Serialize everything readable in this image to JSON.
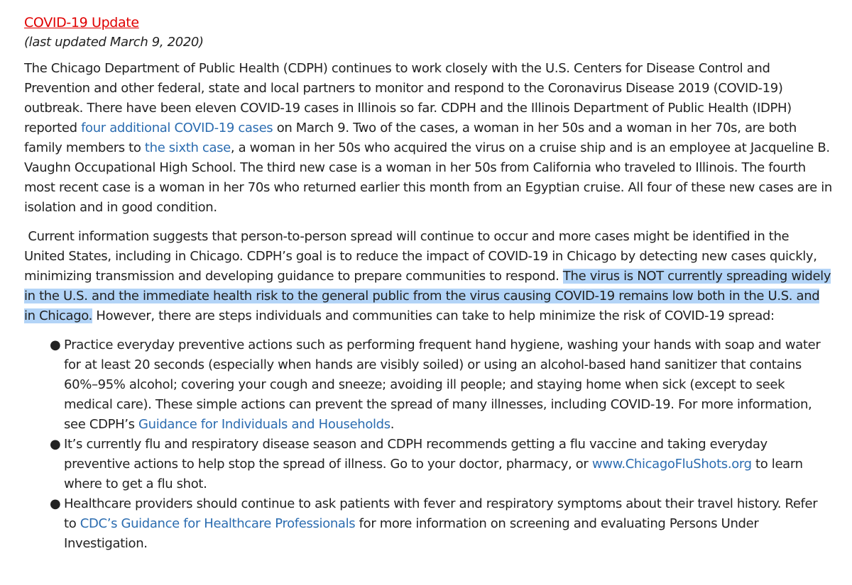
{
  "header": {
    "title": "COVID-19 Update",
    "updated": "(last updated March 9, 2020)"
  },
  "para1": {
    "t1": "The Chicago Department of Public Health (CDPH) continues to work closely with the U.S. Centers for Disease Control and Prevention and other federal, state and local partners to monitor and respond to the Coronavirus Disease 2019 (COVID-19) outbreak. There have been eleven COVID-19 cases in Illinois so far. CDPH and the Illinois Department of Public Health (IDPH) reported ",
    "link1": "four additional COVID-19 cases",
    "t2": " on March 9. Two of the cases, a woman in her 50s and a woman in her 70s, are both family members to ",
    "link2": "the sixth case",
    "t3": ", a woman in her 50s who acquired the virus on a cruise ship and is an employee at Jacqueline B. Vaughn Occupational High School. The third new case is a woman in her 50s from California who traveled to Illinois. The fourth most recent case is a woman in her 70s who returned earlier this month from an Egyptian cruise. All four of these new cases are in isolation and in good condition."
  },
  "para2": {
    "t1": " Current information suggests that person-to-person spread will continue to occur and more cases might be identified in the United States, including in Chicago. CDPH’s goal is to reduce the impact of COVID-19 in Chicago by detecting new cases quickly, minimizing transmission and developing guidance to prepare communities to respond. ",
    "highlight": "The virus is NOT currently spreading widely in the U.S. and the immediate health risk to the general public from the virus causing COVID-19 remains low both in the U.S. and in Chicago.",
    "t2": " However, there are steps individuals and communities can take to help minimize the risk of COVID-19 spread:"
  },
  "bullets": [
    {
      "t1": "Practice everyday preventive actions such as performing frequent hand hygiene, washing your hands with soap and water for at least 20 seconds (especially when hands are visibly soiled) or using an alcohol-based hand sanitizer that contains 60%–95% alcohol; covering your cough and sneeze; avoiding ill people; and staying home when sick (except to seek medical care). These simple actions can prevent the spread of many illnesses, including COVID-19. For more information, see CDPH’s ",
      "link": "Guidance for Individuals and Households",
      "t2": "."
    },
    {
      "t1": "It’s currently flu and respiratory disease season and CDPH recommends getting a flu vaccine and taking everyday preventive actions to help stop the spread of illness. Go to your doctor, pharmacy, or ",
      "link": "www.ChicagoFluShots.org",
      "t2": " to learn where to get a flu shot."
    },
    {
      "t1": "Healthcare providers should continue to ask patients with fever and respiratory symptoms about their travel history. Refer to ",
      "link": "CDC’s Guidance for Healthcare Professionals",
      "t2": " for more information on screening and evaluating Persons Under Investigation."
    }
  ],
  "colors": {
    "title": "#e00000",
    "link": "#2b6cb0",
    "highlight": "#b3d4f7",
    "text": "#222222"
  },
  "icons": {
    "bullet": "bullet-dot-icon"
  }
}
